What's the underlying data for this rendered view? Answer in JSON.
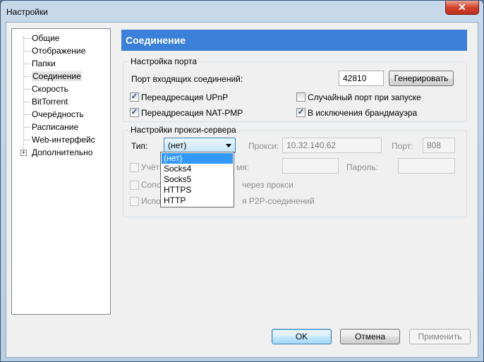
{
  "window": {
    "title": "Настройки",
    "close_glyph": "✕"
  },
  "sidebar": {
    "items": [
      {
        "label": "Общие"
      },
      {
        "label": "Отображение"
      },
      {
        "label": "Папки"
      },
      {
        "label": "Соединение",
        "selected": true
      },
      {
        "label": "Скорость"
      },
      {
        "label": "BitTorrent"
      },
      {
        "label": "Очерёдность"
      },
      {
        "label": "Расписание"
      },
      {
        "label": "Web-интерфейс"
      },
      {
        "label": "Дополнительно",
        "expandable": true
      }
    ],
    "expander_glyph": "+"
  },
  "page": {
    "title": "Соединение"
  },
  "port_settings": {
    "group_title": "Настройка порта",
    "incoming_port_label": "Порт входящих соединений:",
    "incoming_port_value": "42810",
    "generate_label": "Генерировать",
    "upnp_label": "Переадресация UPnP",
    "upnp_checked": true,
    "natpmp_label": "Переадресация NAT-PMP",
    "natpmp_checked": true,
    "random_port_label": "Случайный порт при запуске",
    "random_port_checked": false,
    "firewall_label": "В исключения брандмауэра",
    "firewall_checked": true,
    "check_glyph": "✓"
  },
  "proxy_settings": {
    "group_title": "Настройки прокси-сервера",
    "type_label": "Тип:",
    "type_value": "(нет)",
    "proxy_label": "Прокси:",
    "proxy_value": "10.32.140.62",
    "port_label": "Порт:",
    "port_value": "808",
    "auth_label_visible": "Учётн",
    "name_label_visible": "мя:",
    "password_label": "Пароль:",
    "resolve_label_visible_left": "Сопос",
    "resolve_label_visible_right": "через прокси",
    "p2p_label_visible_left": "Испол",
    "p2p_label_visible_right": "я P2P-соединений"
  },
  "dropdown": {
    "options": [
      "(нет)",
      "Socks4",
      "Socks5",
      "HTTPS",
      "HTTP"
    ],
    "selected_index": 0
  },
  "footer": {
    "ok_label": "OK",
    "cancel_label": "Отмена",
    "apply_label": "Применить"
  }
}
